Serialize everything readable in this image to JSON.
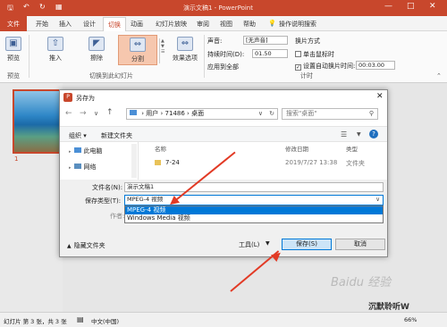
{
  "title_bar": {
    "title": "演示文稿1 - PowerPoint",
    "tell_me": "操作说明搜索"
  },
  "tabs": [
    "文件",
    "开始",
    "插入",
    "设计",
    "切换",
    "动画",
    "幻灯片放映",
    "审阅",
    "视图",
    "帮助"
  ],
  "active_tab": "切换",
  "ribbon": {
    "preview_label": "预览",
    "preview_group": "预览",
    "transition_buttons": [
      "推入",
      "擦除",
      "分割"
    ],
    "effect_options_label": "效果选项",
    "transition_group": "切换到此幻灯片",
    "sound_label": "声音:",
    "sound_value": "[无声音]",
    "duration_label": "持续时间(D):",
    "duration_value": "01.50",
    "apply_all_label": "应用到全部",
    "advance_title": "换片方式",
    "on_click_label": "单击鼠标时",
    "after_label": "设置自动换片时间:",
    "after_value": "00:03.00",
    "timing_group": "计时"
  },
  "slide_number": "1",
  "dialog": {
    "title": "另存为",
    "path": [
      "用户",
      "71486",
      "桌面"
    ],
    "search_placeholder": "搜索\"桌面\"",
    "organize_label": "组织 ▾",
    "new_folder_label": "新建文件夹",
    "nav_items": [
      "此电脑",
      "网络"
    ],
    "columns": [
      "名称",
      "修改日期",
      "类型"
    ],
    "files": [
      {
        "name": "7-24",
        "date": "2019/7/27 13:38",
        "type": "文件夹"
      }
    ],
    "filename_label": "文件名(N):",
    "filename_value": "演示文稿1",
    "filetype_label": "保存类型(T):",
    "filetype_value": "MPEG-4 视频",
    "author_label": "作者:",
    "dropdown_options": [
      "MPEG-4 视频",
      "Windows Media 视频"
    ],
    "selected_option": 0,
    "hide_folders_label": "隐藏文件夹",
    "tools_label": "工具(L)",
    "save_label": "保存(S)",
    "cancel_label": "取消"
  },
  "status_bar": {
    "slide_info": "幻灯片 第 3 张，共 3 张",
    "language": "中文(中国)",
    "zoom": "66%"
  },
  "watermark": "Baidu 经验",
  "credit": "沉默聆听W",
  "colors": {
    "accent": "#c8472c",
    "selection": "#0078d7",
    "annotation": "#e23a25"
  }
}
